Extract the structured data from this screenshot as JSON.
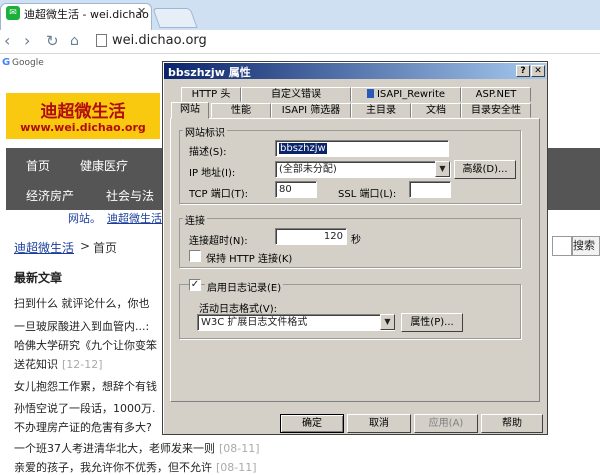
{
  "browser": {
    "tab_title": "迪超微生活 - wei.dichao",
    "tab_close": "✕",
    "url": "wei.dichao.org",
    "bookmark_label": "Google"
  },
  "site": {
    "logo_name": "迪超微生活",
    "logo_url": "www.wei.dichao.org",
    "nav": [
      "首页",
      "健康医疗",
      "经济房产",
      "社会与法"
    ],
    "sublinks": [
      "网站。",
      "迪超微生活"
    ],
    "breadcrumb_home": "迪超微生活",
    "breadcrumb_sep": ">",
    "breadcrumb_current": "首页",
    "search_button": "搜索",
    "latest_title": "最新文章",
    "articles": [
      {
        "text": "扫到什么 就评论什么，你也",
        "date": ""
      },
      {
        "text": "一旦玻尿酸进入到血管内...:",
        "date": ""
      },
      {
        "text": "哈佛大学研究《九个让你变笨",
        "date": ""
      },
      {
        "text": "送花知识",
        "date": "[12-12]"
      },
      {
        "text": "女儿抱怨工作累，想辞个有钱",
        "date": ""
      },
      {
        "text": "孙悟空说了一段话，1000万.",
        "date": ""
      },
      {
        "text": "不办理房产证的危害有多大?",
        "date": ""
      },
      {
        "text": "一个班37人考进清华北大，老师发来一则",
        "date": "[08-11]"
      },
      {
        "text": "亲爱的孩子，我允许你不优秀，但不允许",
        "date": "[08-11]"
      }
    ]
  },
  "dialog": {
    "title": "bbszhzjw 属性",
    "help_btn": "?",
    "close_btn": "✕",
    "tabs_back": [
      "HTTP 头",
      "自定义错误",
      "ISAPI_Rewrite",
      "ASP.NET"
    ],
    "tabs_front": [
      "网站",
      "性能",
      "ISAPI 筛选器",
      "主目录",
      "文档",
      "目录安全性"
    ],
    "group_identity": "网站标识",
    "desc_label": "描述(S):",
    "desc_value": "bbszhzjw",
    "ip_label": "IP 地址(I):",
    "ip_value": "(全部未分配)",
    "advanced_btn": "高级(D)...",
    "tcp_label": "TCP 端口(T):",
    "tcp_value": "80",
    "ssl_label": "SSL 端口(L):",
    "ssl_value": "",
    "group_conn": "连接",
    "timeout_label": "连接超时(N):",
    "timeout_value": "120",
    "timeout_unit": "秒",
    "keepalive_label": "保持 HTTP 连接(K)",
    "keepalive_checked": false,
    "logging_label": "启用日志记录(E)",
    "logging_checked": true,
    "log_format_label": "活动日志格式(V):",
    "log_format_value": "W3C 扩展日志文件格式",
    "properties_btn": "属性(P)...",
    "ok_btn": "确定",
    "cancel_btn": "取消",
    "apply_btn": "应用(A)",
    "help_bottom_btn": "帮助"
  }
}
